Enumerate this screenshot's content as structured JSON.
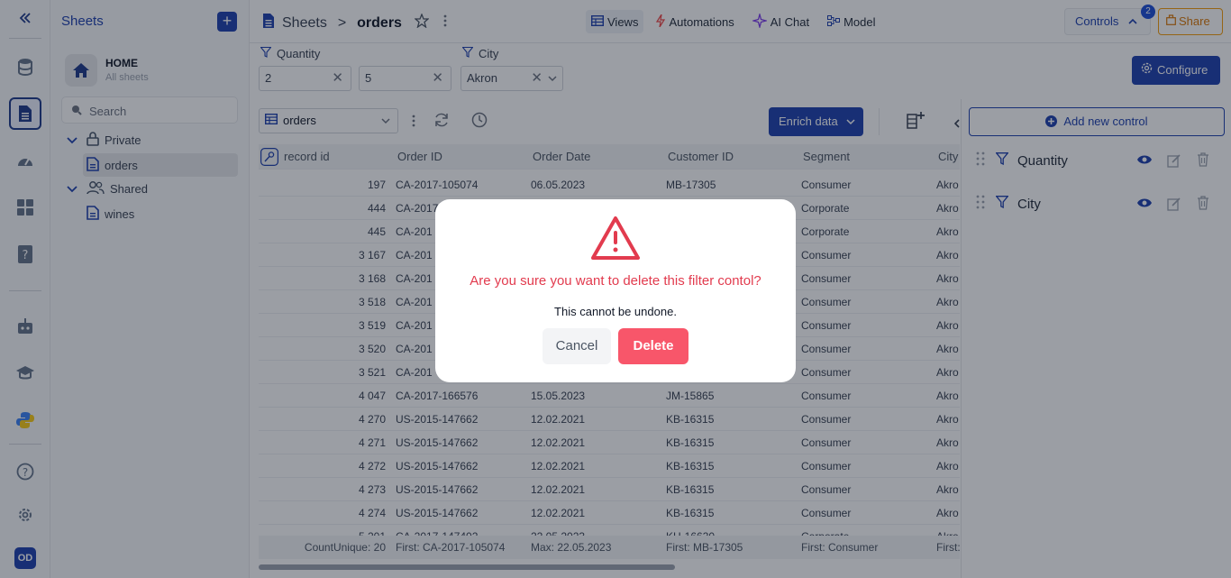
{
  "sheets_panel": {
    "title": "Sheets",
    "add": "+",
    "home_title": "HOME",
    "home_subtitle": "All sheets",
    "search_placeholder": "Search",
    "tree": {
      "private": "Private",
      "orders": "orders",
      "shared": "Shared",
      "wines": "wines"
    }
  },
  "rail": {
    "avatar": "OD"
  },
  "header": {
    "breadcrumb_root": "Sheets",
    "breadcrumb_sep": ">",
    "breadcrumb_current": "orders",
    "tabs": {
      "views": "Views",
      "automations": "Automations",
      "ai_chat": "AI Chat",
      "model": "Model"
    },
    "controls": "Controls",
    "controls_badge": "2",
    "share": "Share"
  },
  "filters": {
    "quantity_label": "Quantity",
    "quantity_min": "2",
    "quantity_max": "5",
    "city_label": "City",
    "city_value": "Akron",
    "configure": "Configure"
  },
  "toolbar": {
    "sheet": "orders",
    "enrich": "Enrich data"
  },
  "table": {
    "headers": [
      "record id",
      "Order ID",
      "Order Date",
      "Customer ID",
      "Segment",
      "City"
    ],
    "rows": [
      [
        "197",
        "CA-2017-105074",
        "06.05.2023",
        "MB-17305",
        "Consumer",
        "Akro"
      ],
      [
        "444",
        "CA-2017",
        "",
        "",
        "Corporate",
        "Akro"
      ],
      [
        "445",
        "CA-201",
        "",
        "",
        "Corporate",
        "Akro"
      ],
      [
        "3 167",
        "CA-201",
        "",
        "",
        "Consumer",
        "Akro"
      ],
      [
        "3 168",
        "CA-201",
        "",
        "",
        "Consumer",
        "Akro"
      ],
      [
        "3 518",
        "CA-201",
        "",
        "",
        "Consumer",
        "Akro"
      ],
      [
        "3 519",
        "CA-201",
        "",
        "",
        "Consumer",
        "Akro"
      ],
      [
        "3 520",
        "CA-201",
        "",
        "",
        "Consumer",
        "Akro"
      ],
      [
        "3 521",
        "CA-201",
        "",
        "",
        "Consumer",
        "Akro"
      ],
      [
        "4 047",
        "CA-2017-166576",
        "15.05.2023",
        "JM-15865",
        "Consumer",
        "Akro"
      ],
      [
        "4 270",
        "US-2015-147662",
        "12.02.2021",
        "KB-16315",
        "Consumer",
        "Akro"
      ],
      [
        "4 271",
        "US-2015-147662",
        "12.02.2021",
        "KB-16315",
        "Consumer",
        "Akro"
      ],
      [
        "4 272",
        "US-2015-147662",
        "12.02.2021",
        "KB-16315",
        "Consumer",
        "Akro"
      ],
      [
        "4 273",
        "US-2015-147662",
        "12.02.2021",
        "KB-16315",
        "Consumer",
        "Akro"
      ],
      [
        "4 274",
        "US-2015-147662",
        "12.02.2021",
        "KB-16315",
        "Consumer",
        "Akro"
      ],
      [
        "5 201",
        "CA-2017-147402",
        "22.05.2023",
        "KH-16630",
        "Corporate",
        "Akro"
      ]
    ],
    "footer": [
      "CountUnique: 20",
      "First: CA-2017-105074",
      "Max: 22.05.2023",
      "First: MB-17305",
      "First: Consumer",
      "First:"
    ]
  },
  "control_panel": {
    "add_control": "Add new control",
    "controls": [
      "Quantity",
      "City"
    ]
  },
  "modal": {
    "message": "Are you sure you want to delete this filter contol?",
    "sub": "This cannot be undone.",
    "cancel": "Cancel",
    "delete": "Delete"
  },
  "colors": {
    "brand": "#1e40af",
    "danger": "#e23b4e",
    "delete_button": "#f8566a",
    "share": "#d97706"
  }
}
